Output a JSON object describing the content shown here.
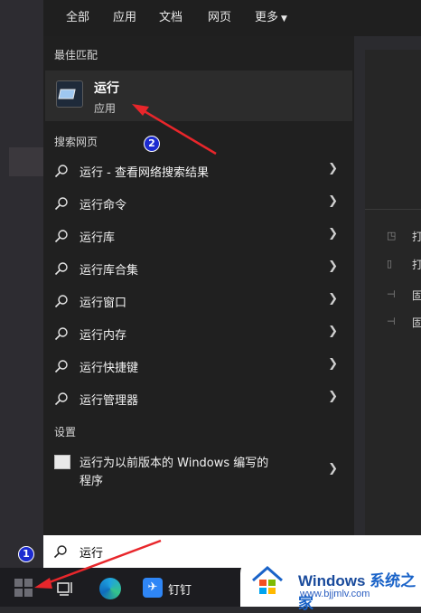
{
  "tabs": [
    {
      "label": "全部"
    },
    {
      "label": "应用"
    },
    {
      "label": "文档"
    },
    {
      "label": "网页"
    },
    {
      "label": "更多"
    }
  ],
  "best_match": {
    "header": "最佳匹配",
    "title": "运行",
    "subtitle": "应用"
  },
  "web": {
    "header": "搜索网页",
    "items": [
      {
        "label": "运行 - 查看网络搜索结果"
      },
      {
        "label": "运行命令"
      },
      {
        "label": "运行库"
      },
      {
        "label": "运行库合集"
      },
      {
        "label": "运行窗口"
      },
      {
        "label": "运行内存"
      },
      {
        "label": "运行快捷键"
      },
      {
        "label": "运行管理器"
      }
    ]
  },
  "settings": {
    "header": "设置",
    "line1": "运行为以前版本的 Windows 编写的",
    "line2": "程序"
  },
  "right_pane": {
    "items": [
      {
        "icon": "open-icon",
        "label": "打"
      },
      {
        "icon": "folder-icon",
        "label": "打"
      },
      {
        "icon": "pin-icon",
        "label": "固"
      },
      {
        "icon": "pin-icon",
        "label": "固"
      }
    ]
  },
  "search": {
    "value": "运行"
  },
  "taskbar": {
    "dingding_label": "钉钉"
  },
  "annotations": {
    "badge1": "1",
    "badge2": "2"
  },
  "watermark": {
    "brand": "Windows",
    "brand_cn": "系统之家",
    "url": "www.bjjmlv.com"
  },
  "colors": {
    "accent_red": "#e8262b",
    "badge_blue": "#1c2bd0",
    "panel_bg": "#202020"
  }
}
